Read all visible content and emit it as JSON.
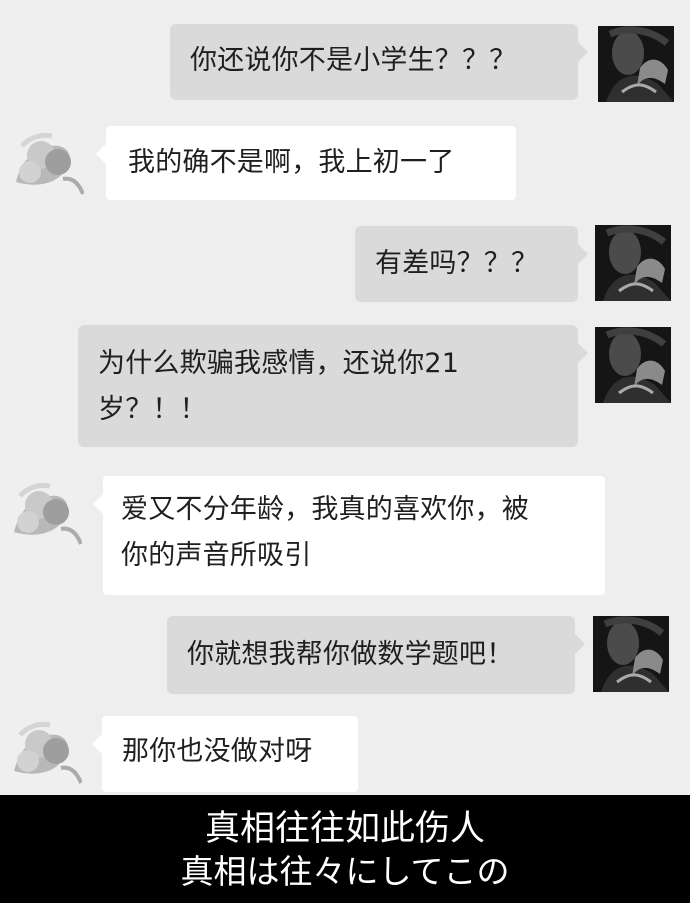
{
  "messages": [
    {
      "side": "right",
      "text": "你还说你不是小学生？？？"
    },
    {
      "side": "left",
      "text": "我的确不是啊，我上初一了"
    },
    {
      "side": "right",
      "text": "有差吗？？？"
    },
    {
      "side": "right",
      "line1": "为什么欺骗我感情，还说你21",
      "line2": "岁？！！"
    },
    {
      "side": "left",
      "line1": "爱又不分年龄，我真的喜欢你，被",
      "line2": "你的声音所吸引"
    },
    {
      "side": "right",
      "text": "你就想我帮你做数学题吧！"
    },
    {
      "side": "left",
      "text": "那你也没做对呀"
    }
  ],
  "subtitle": {
    "chinese": "真相往往如此伤人",
    "japanese": "真相は往々にしてこの"
  },
  "colors": {
    "background": "#eeeeee",
    "right_bubble": "#dadada",
    "left_bubble": "#ffffff",
    "subtitle_bar": "#000000"
  },
  "avatars": {
    "right": "dark-profile-avatar",
    "left": "flower-avatar"
  }
}
